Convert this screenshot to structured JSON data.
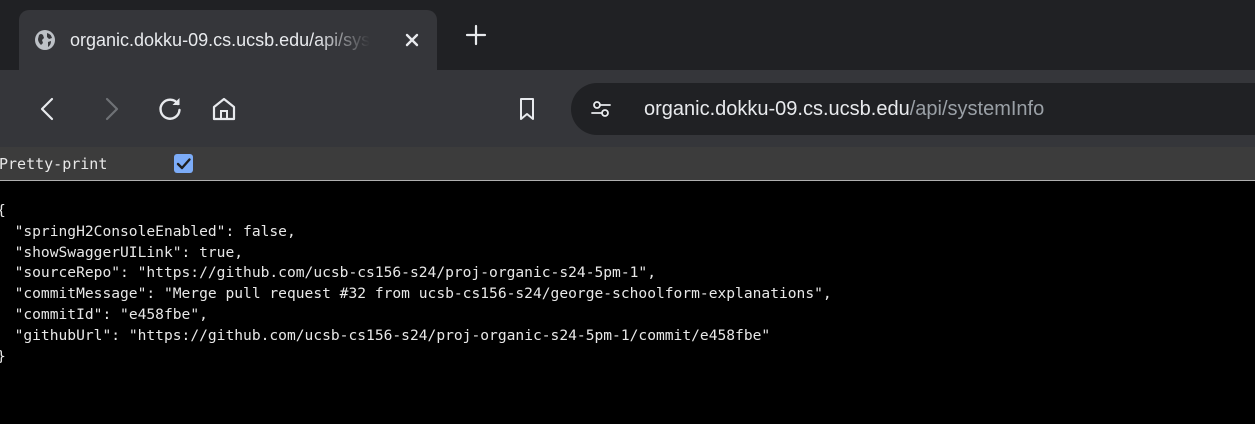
{
  "tab": {
    "title": "organic.dokku-09.cs.ucsb.edu/api/systemInfo",
    "favicon": "globe-icon",
    "close_icon": "close-icon",
    "new_tab_icon": "plus-icon"
  },
  "toolbar": {
    "back_icon": "chevron-left-icon",
    "forward_icon": "chevron-right-icon",
    "reload_icon": "reload-icon",
    "home_icon": "home-icon",
    "bookmark_icon": "bookmark-icon",
    "site_info_icon": "tune-icon"
  },
  "address_bar": {
    "host": "organic.dokku-09.cs.ucsb.edu",
    "path": "/api/systemInfo"
  },
  "json_viewer": {
    "pretty_print_label": "Pretty-print",
    "pretty_print_checked": true,
    "open_brace": "{",
    "close_brace": "}",
    "entries": [
      {
        "key": "\"springH2ConsoleEnabled\"",
        "value": "false"
      },
      {
        "key": "\"showSwaggerUILink\"",
        "value": "true"
      },
      {
        "key": "\"sourceRepo\"",
        "value": "\"https://github.com/ucsb-cs156-s24/proj-organic-s24-5pm-1\""
      },
      {
        "key": "\"commitMessage\"",
        "value": "\"Merge pull request #32 from ucsb-cs156-s24/george-schoolform-explanations\""
      },
      {
        "key": "\"commitId\"",
        "value": "\"e458fbe\""
      },
      {
        "key": "\"githubUrl\"",
        "value": "\"https://github.com/ucsb-cs156-s24/proj-organic-s24-5pm-1/commit/e458fbe\""
      }
    ]
  },
  "colors": {
    "tabstrip": "#202124",
    "toolbar": "#35363a",
    "omnibox": "#202124",
    "url_host": "#e8eaed",
    "url_path": "#9aa0a6",
    "checkbox": "#7cacf8",
    "viewer_background": "#000000",
    "viewer_text": "#e8e8e8"
  }
}
